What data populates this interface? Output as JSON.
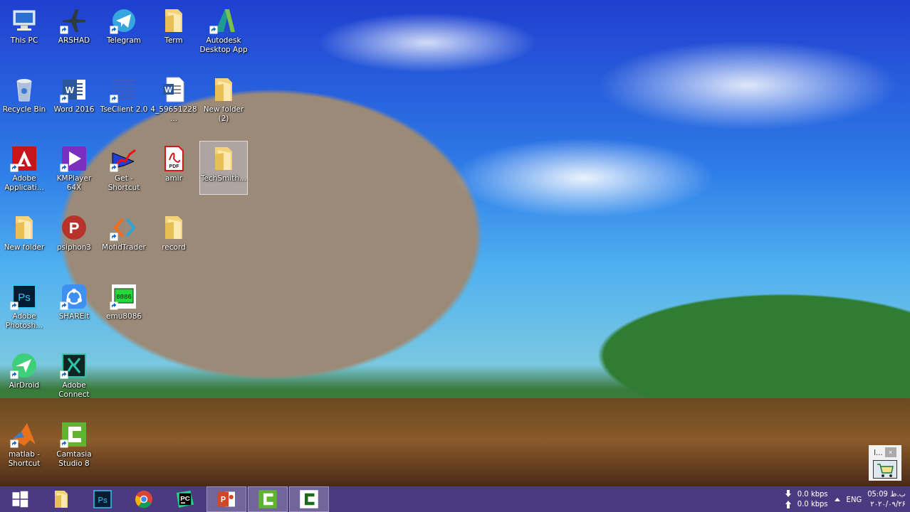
{
  "desktop": {
    "rows": [
      {
        "icons": [
          {
            "label": "This PC",
            "kind": "pc",
            "shortcut": false,
            "selected": false
          },
          {
            "label": "ARSHAD",
            "kind": "plane",
            "shortcut": true,
            "selected": false
          },
          {
            "label": "Telegram",
            "kind": "telegram",
            "shortcut": true,
            "selected": false
          },
          {
            "label": "Term",
            "kind": "folder",
            "shortcut": false,
            "selected": false
          },
          {
            "label": "Autodesk Desktop App",
            "kind": "autodesk",
            "shortcut": true,
            "selected": false
          }
        ]
      },
      {
        "icons": [
          {
            "label": "Recycle Bin",
            "kind": "recycle",
            "shortcut": false,
            "selected": false
          },
          {
            "label": "Word 2016",
            "kind": "word",
            "glyph": "W",
            "shortcut": true,
            "selected": false
          },
          {
            "label": "TseClient 2.0",
            "kind": "stripes",
            "shortcut": true,
            "selected": false
          },
          {
            "label": "4_59651228...",
            "kind": "worddoc",
            "glyph": "W",
            "shortcut": false,
            "selected": false
          },
          {
            "label": "New folder (2)",
            "kind": "folder",
            "shortcut": false,
            "selected": false
          }
        ]
      },
      {
        "icons": [
          {
            "label": "Adobe Applicati...",
            "kind": "adobe",
            "shortcut": true,
            "selected": false
          },
          {
            "label": "KMPlayer 64X",
            "kind": "kmplayer",
            "shortcut": true,
            "selected": false
          },
          {
            "label": "Get - Shortcut",
            "kind": "chart",
            "shortcut": true,
            "selected": false
          },
          {
            "label": "amir",
            "kind": "pdf",
            "glyph": "PDF",
            "shortcut": false,
            "selected": false
          },
          {
            "label": "TechSmith...",
            "kind": "folder",
            "shortcut": false,
            "selected": true
          }
        ]
      },
      {
        "icons": [
          {
            "label": "New folder",
            "kind": "folder",
            "shortcut": false,
            "selected": false
          },
          {
            "label": "psiphon3",
            "kind": "psiphon",
            "glyph": "P",
            "shortcut": false,
            "selected": false
          },
          {
            "label": "MofidTrader",
            "kind": "chevrons",
            "shortcut": true,
            "selected": false
          },
          {
            "label": "record",
            "kind": "folder",
            "shortcut": false,
            "selected": false
          }
        ]
      },
      {
        "icons": [
          {
            "label": "Adobe Photosh...",
            "kind": "ps",
            "glyph": "Ps",
            "shortcut": true,
            "selected": false
          },
          {
            "label": "SHAREit",
            "kind": "shareit",
            "shortcut": true,
            "selected": false
          },
          {
            "label": "emu8086",
            "kind": "chip",
            "glyph": "8086",
            "shortcut": true,
            "selected": false
          }
        ]
      },
      {
        "icons": [
          {
            "label": "AirDroid",
            "kind": "airdroid",
            "shortcut": true,
            "selected": false
          },
          {
            "label": "Adobe Connect",
            "kind": "connect",
            "shortcut": true,
            "selected": false
          }
        ]
      },
      {
        "icons": [
          {
            "label": "matlab - Shortcut",
            "kind": "matlab",
            "shortcut": true,
            "selected": false
          },
          {
            "label": "Camtasia Studio 8",
            "kind": "camtasia",
            "shortcut": true,
            "selected": false
          }
        ]
      }
    ]
  },
  "widget": {
    "title": "l...",
    "close": "×"
  },
  "taskbar": {
    "items": [
      {
        "kind": "start",
        "open": false
      },
      {
        "kind": "folder",
        "open": false
      },
      {
        "kind": "ps",
        "glyph": "Ps",
        "open": false
      },
      {
        "kind": "chrome",
        "open": false
      },
      {
        "kind": "pycharm",
        "glyph": "PC",
        "open": false
      },
      {
        "kind": "ppt",
        "glyph": "P",
        "open": true
      },
      {
        "kind": "camtasia",
        "open": true
      },
      {
        "kind": "camtasia-light",
        "open": true
      }
    ],
    "network": {
      "down": "0.0 kbps",
      "up": "0.0 kbps"
    },
    "language": "ENG",
    "time": "ب.ظ 05:09",
    "date": "۲۰۲۰/۰۹/۲۶"
  }
}
